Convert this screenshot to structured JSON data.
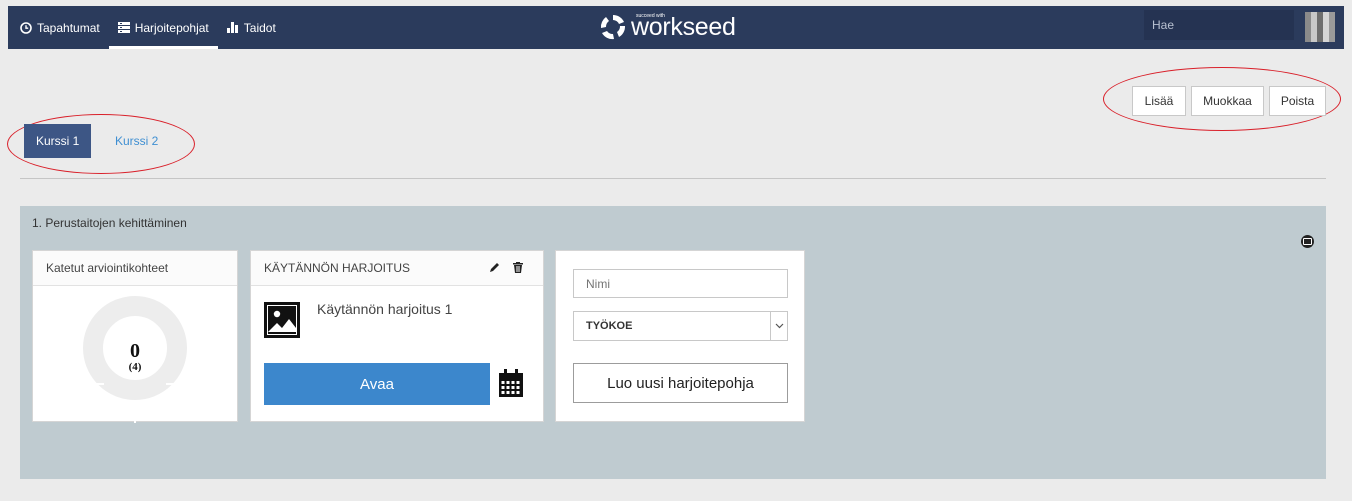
{
  "nav": {
    "items": [
      {
        "label": "Tapahtumat",
        "icon": "clock-icon"
      },
      {
        "label": "Harjoitepohjat",
        "icon": "list-icon",
        "active": true
      },
      {
        "label": "Taidot",
        "icon": "bar-chart-icon"
      }
    ],
    "logo_text": "workseed",
    "logo_tagline": "succeed with",
    "search_placeholder": "Hae"
  },
  "actions": {
    "add": "Lisää",
    "edit": "Muokkaa",
    "delete": "Poista"
  },
  "tabs": [
    {
      "label": "Kurssi 1",
      "active": true
    },
    {
      "label": "Kurssi 2",
      "active": false
    }
  ],
  "section": {
    "title": "1. Perustaitojen kehittäminen",
    "progress_card": {
      "title": "Katetut arviointikohteet",
      "value": "0",
      "total": "(4)"
    },
    "exercise_card": {
      "title": "KÄYTÄNNÖN HARJOITUS",
      "item_name": "Käytännön harjoitus 1",
      "open_label": "Avaa"
    },
    "new_form": {
      "name_placeholder": "Nimi",
      "type_value": "TYÖKOE",
      "create_label": "Luo uusi harjoitepohja"
    }
  },
  "colors": {
    "navbar": "#2b3b5c",
    "tab_active": "#3d5685",
    "link": "#3f8fd2",
    "primary_button": "#3c87cc",
    "section_bg": "#bfcbd0",
    "annotation": "#d9202a"
  }
}
